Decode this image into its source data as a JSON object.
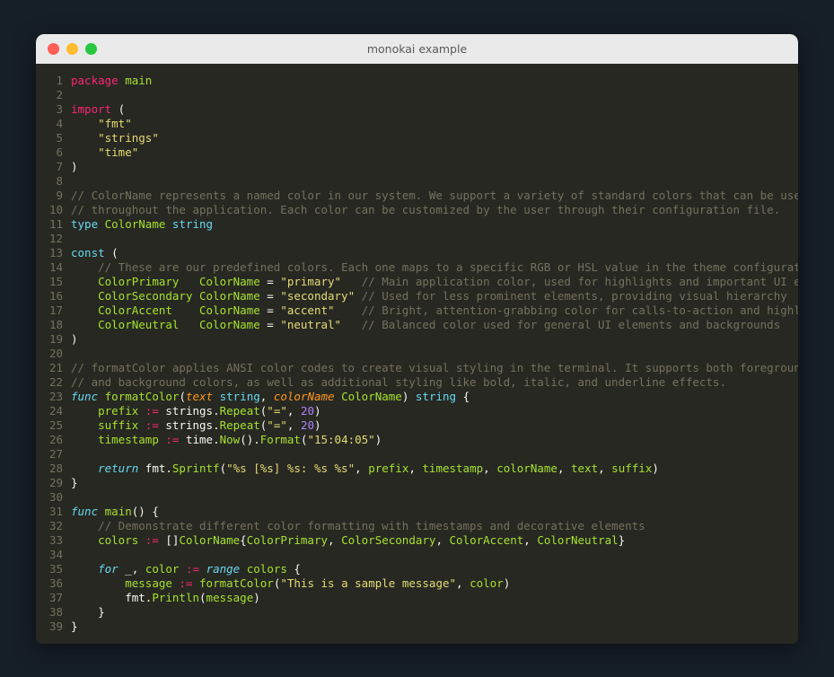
{
  "window": {
    "title": "monokai example",
    "traffic_lights": [
      {
        "name": "close-button",
        "color": "#ff5f57"
      },
      {
        "name": "minimize-button",
        "color": "#febc2e"
      },
      {
        "name": "maximize-button",
        "color": "#28c840"
      }
    ]
  },
  "theme": {
    "name": "monokai",
    "page_background": "#161e27",
    "titlebar_background": "#eaeaea",
    "titlebar_text": "#58595b",
    "code_background": "#272822",
    "foreground": "#f8f8f2",
    "comment": "#75715e",
    "keyword": "#f92672",
    "type_cyan": "#66d9ef",
    "identifier_green": "#a6e22e",
    "string_yellow": "#e6db74",
    "number_purple": "#ae81ff",
    "param_orange": "#fd971f",
    "linenumber": "#75715e"
  },
  "code": {
    "language": "go",
    "lines": [
      {
        "n": "1",
        "tokens": [
          {
            "t": "package",
            "c": "t-key"
          },
          {
            "t": " ",
            "c": "t-plain"
          },
          {
            "t": "main",
            "c": "t-fn"
          }
        ]
      },
      {
        "n": "2",
        "tokens": []
      },
      {
        "n": "3",
        "tokens": [
          {
            "t": "import",
            "c": "t-key"
          },
          {
            "t": " (",
            "c": "t-plain"
          }
        ]
      },
      {
        "n": "4",
        "tokens": [
          {
            "t": "    ",
            "c": "t-plain"
          },
          {
            "t": "\"fmt\"",
            "c": "t-str"
          }
        ]
      },
      {
        "n": "5",
        "tokens": [
          {
            "t": "    ",
            "c": "t-plain"
          },
          {
            "t": "\"strings\"",
            "c": "t-str"
          }
        ]
      },
      {
        "n": "6",
        "tokens": [
          {
            "t": "    ",
            "c": "t-plain"
          },
          {
            "t": "\"time\"",
            "c": "t-str"
          }
        ]
      },
      {
        "n": "7",
        "tokens": [
          {
            "t": ")",
            "c": "t-plain"
          }
        ]
      },
      {
        "n": "8",
        "tokens": []
      },
      {
        "n": "9",
        "tokens": [
          {
            "t": "// ColorName represents a named color in our system. We support a variety of standard colors that can be used",
            "c": "t-com"
          }
        ]
      },
      {
        "n": "10",
        "tokens": [
          {
            "t": "// throughout the application. Each color can be customized by the user through their configuration file.",
            "c": "t-com"
          }
        ]
      },
      {
        "n": "11",
        "tokens": [
          {
            "t": "type",
            "c": "t-kwp"
          },
          {
            "t": " ",
            "c": "t-plain"
          },
          {
            "t": "ColorName",
            "c": "t-fn"
          },
          {
            "t": " ",
            "c": "t-plain"
          },
          {
            "t": "string",
            "c": "t-kwp"
          }
        ]
      },
      {
        "n": "12",
        "tokens": []
      },
      {
        "n": "13",
        "tokens": [
          {
            "t": "const",
            "c": "t-kwp"
          },
          {
            "t": " (",
            "c": "t-plain"
          }
        ]
      },
      {
        "n": "14",
        "tokens": [
          {
            "t": "    ",
            "c": "t-plain"
          },
          {
            "t": "// These are our predefined colors. Each one maps to a specific RGB or HSL value in the theme configuration.",
            "c": "t-com"
          }
        ]
      },
      {
        "n": "15",
        "tokens": [
          {
            "t": "    ",
            "c": "t-plain"
          },
          {
            "t": "ColorPrimary",
            "c": "t-fn"
          },
          {
            "t": "   ",
            "c": "t-plain"
          },
          {
            "t": "ColorName",
            "c": "t-fn"
          },
          {
            "t": " = ",
            "c": "t-plain"
          },
          {
            "t": "\"primary\"",
            "c": "t-str"
          },
          {
            "t": "   ",
            "c": "t-plain"
          },
          {
            "t": "// Main application color, used for highlights and important UI elements",
            "c": "t-com"
          }
        ]
      },
      {
        "n": "16",
        "tokens": [
          {
            "t": "    ",
            "c": "t-plain"
          },
          {
            "t": "ColorSecondary",
            "c": "t-fn"
          },
          {
            "t": " ",
            "c": "t-plain"
          },
          {
            "t": "ColorName",
            "c": "t-fn"
          },
          {
            "t": " = ",
            "c": "t-plain"
          },
          {
            "t": "\"secondary\"",
            "c": "t-str"
          },
          {
            "t": " ",
            "c": "t-plain"
          },
          {
            "t": "// Used for less prominent elements, providing visual hierarchy",
            "c": "t-com"
          }
        ]
      },
      {
        "n": "17",
        "tokens": [
          {
            "t": "    ",
            "c": "t-plain"
          },
          {
            "t": "ColorAccent",
            "c": "t-fn"
          },
          {
            "t": "    ",
            "c": "t-plain"
          },
          {
            "t": "ColorName",
            "c": "t-fn"
          },
          {
            "t": " = ",
            "c": "t-plain"
          },
          {
            "t": "\"accent\"",
            "c": "t-str"
          },
          {
            "t": "    ",
            "c": "t-plain"
          },
          {
            "t": "// Bright, attention-grabbing color for calls-to-action and highlights",
            "c": "t-com"
          }
        ]
      },
      {
        "n": "18",
        "tokens": [
          {
            "t": "    ",
            "c": "t-plain"
          },
          {
            "t": "ColorNeutral",
            "c": "t-fn"
          },
          {
            "t": "   ",
            "c": "t-plain"
          },
          {
            "t": "ColorName",
            "c": "t-fn"
          },
          {
            "t": " = ",
            "c": "t-plain"
          },
          {
            "t": "\"neutral\"",
            "c": "t-str"
          },
          {
            "t": "   ",
            "c": "t-plain"
          },
          {
            "t": "// Balanced color used for general UI elements and backgrounds",
            "c": "t-com"
          }
        ]
      },
      {
        "n": "19",
        "tokens": [
          {
            "t": ")",
            "c": "t-plain"
          }
        ]
      },
      {
        "n": "20",
        "tokens": []
      },
      {
        "n": "21",
        "tokens": [
          {
            "t": "// formatColor applies ANSI color codes to create visual styling in the terminal. It supports both foreground",
            "c": "t-com"
          }
        ]
      },
      {
        "n": "22",
        "tokens": [
          {
            "t": "// and background colors, as well as additional styling like bold, italic, and underline effects.",
            "c": "t-com"
          }
        ]
      },
      {
        "n": "23",
        "tokens": [
          {
            "t": "func",
            "c": "t-kw2"
          },
          {
            "t": " ",
            "c": "t-plain"
          },
          {
            "t": "formatColor",
            "c": "t-fn"
          },
          {
            "t": "(",
            "c": "t-plain"
          },
          {
            "t": "text",
            "c": "t-param"
          },
          {
            "t": " ",
            "c": "t-plain"
          },
          {
            "t": "string",
            "c": "t-kwp"
          },
          {
            "t": ", ",
            "c": "t-plain"
          },
          {
            "t": "colorName",
            "c": "t-param"
          },
          {
            "t": " ",
            "c": "t-plain"
          },
          {
            "t": "ColorName",
            "c": "t-fn"
          },
          {
            "t": ") ",
            "c": "t-plain"
          },
          {
            "t": "string",
            "c": "t-kwp"
          },
          {
            "t": " {",
            "c": "t-plain"
          }
        ]
      },
      {
        "n": "24",
        "tokens": [
          {
            "t": "    ",
            "c": "t-plain"
          },
          {
            "t": "prefix",
            "c": "t-fn"
          },
          {
            "t": " ",
            "c": "t-plain"
          },
          {
            "t": ":=",
            "c": "t-op"
          },
          {
            "t": " ",
            "c": "t-plain"
          },
          {
            "t": "strings",
            "c": "t-plain"
          },
          {
            "t": ".",
            "c": "t-plain"
          },
          {
            "t": "Repeat",
            "c": "t-fn"
          },
          {
            "t": "(",
            "c": "t-plain"
          },
          {
            "t": "\"=\"",
            "c": "t-str"
          },
          {
            "t": ", ",
            "c": "t-plain"
          },
          {
            "t": "20",
            "c": "t-num"
          },
          {
            "t": ")",
            "c": "t-plain"
          }
        ]
      },
      {
        "n": "25",
        "tokens": [
          {
            "t": "    ",
            "c": "t-plain"
          },
          {
            "t": "suffix",
            "c": "t-fn"
          },
          {
            "t": " ",
            "c": "t-plain"
          },
          {
            "t": ":=",
            "c": "t-op"
          },
          {
            "t": " ",
            "c": "t-plain"
          },
          {
            "t": "strings",
            "c": "t-plain"
          },
          {
            "t": ".",
            "c": "t-plain"
          },
          {
            "t": "Repeat",
            "c": "t-fn"
          },
          {
            "t": "(",
            "c": "t-plain"
          },
          {
            "t": "\"=\"",
            "c": "t-str"
          },
          {
            "t": ", ",
            "c": "t-plain"
          },
          {
            "t": "20",
            "c": "t-num"
          },
          {
            "t": ")",
            "c": "t-plain"
          }
        ]
      },
      {
        "n": "26",
        "tokens": [
          {
            "t": "    ",
            "c": "t-plain"
          },
          {
            "t": "timestamp",
            "c": "t-fn"
          },
          {
            "t": " ",
            "c": "t-plain"
          },
          {
            "t": ":=",
            "c": "t-op"
          },
          {
            "t": " ",
            "c": "t-plain"
          },
          {
            "t": "time",
            "c": "t-plain"
          },
          {
            "t": ".",
            "c": "t-plain"
          },
          {
            "t": "Now",
            "c": "t-fn"
          },
          {
            "t": "().",
            "c": "t-plain"
          },
          {
            "t": "Format",
            "c": "t-fn"
          },
          {
            "t": "(",
            "c": "t-plain"
          },
          {
            "t": "\"15:04:05\"",
            "c": "t-str"
          },
          {
            "t": ")",
            "c": "t-plain"
          }
        ]
      },
      {
        "n": "27",
        "tokens": []
      },
      {
        "n": "28",
        "tokens": [
          {
            "t": "    ",
            "c": "t-plain"
          },
          {
            "t": "return",
            "c": "t-kw2"
          },
          {
            "t": " ",
            "c": "t-plain"
          },
          {
            "t": "fmt",
            "c": "t-plain"
          },
          {
            "t": ".",
            "c": "t-plain"
          },
          {
            "t": "Sprintf",
            "c": "t-fn"
          },
          {
            "t": "(",
            "c": "t-plain"
          },
          {
            "t": "\"%s [%s] %s: %s %s\"",
            "c": "t-str"
          },
          {
            "t": ", ",
            "c": "t-plain"
          },
          {
            "t": "prefix",
            "c": "t-fn"
          },
          {
            "t": ", ",
            "c": "t-plain"
          },
          {
            "t": "timestamp",
            "c": "t-fn"
          },
          {
            "t": ", ",
            "c": "t-plain"
          },
          {
            "t": "colorName",
            "c": "t-fn"
          },
          {
            "t": ", ",
            "c": "t-plain"
          },
          {
            "t": "text",
            "c": "t-fn"
          },
          {
            "t": ", ",
            "c": "t-plain"
          },
          {
            "t": "suffix",
            "c": "t-fn"
          },
          {
            "t": ")",
            "c": "t-plain"
          }
        ]
      },
      {
        "n": "29",
        "tokens": [
          {
            "t": "}",
            "c": "t-plain"
          }
        ]
      },
      {
        "n": "30",
        "tokens": []
      },
      {
        "n": "31",
        "tokens": [
          {
            "t": "func",
            "c": "t-kw2"
          },
          {
            "t": " ",
            "c": "t-plain"
          },
          {
            "t": "main",
            "c": "t-fn"
          },
          {
            "t": "() {",
            "c": "t-plain"
          }
        ]
      },
      {
        "n": "32",
        "tokens": [
          {
            "t": "    ",
            "c": "t-plain"
          },
          {
            "t": "// Demonstrate different color formatting with timestamps and decorative elements",
            "c": "t-com"
          }
        ]
      },
      {
        "n": "33",
        "tokens": [
          {
            "t": "    ",
            "c": "t-plain"
          },
          {
            "t": "colors",
            "c": "t-fn"
          },
          {
            "t": " ",
            "c": "t-plain"
          },
          {
            "t": ":=",
            "c": "t-op"
          },
          {
            "t": " []",
            "c": "t-plain"
          },
          {
            "t": "ColorName",
            "c": "t-fn"
          },
          {
            "t": "{",
            "c": "t-plain"
          },
          {
            "t": "ColorPrimary",
            "c": "t-fn"
          },
          {
            "t": ", ",
            "c": "t-plain"
          },
          {
            "t": "ColorSecondary",
            "c": "t-fn"
          },
          {
            "t": ", ",
            "c": "t-plain"
          },
          {
            "t": "ColorAccent",
            "c": "t-fn"
          },
          {
            "t": ", ",
            "c": "t-plain"
          },
          {
            "t": "ColorNeutral",
            "c": "t-fn"
          },
          {
            "t": "}",
            "c": "t-plain"
          }
        ]
      },
      {
        "n": "34",
        "tokens": []
      },
      {
        "n": "35",
        "tokens": [
          {
            "t": "    ",
            "c": "t-plain"
          },
          {
            "t": "for",
            "c": "t-kw2"
          },
          {
            "t": " ",
            "c": "t-plain"
          },
          {
            "t": "_",
            "c": "t-plain"
          },
          {
            "t": ", ",
            "c": "t-plain"
          },
          {
            "t": "color",
            "c": "t-fn"
          },
          {
            "t": " ",
            "c": "t-plain"
          },
          {
            "t": ":=",
            "c": "t-op"
          },
          {
            "t": " ",
            "c": "t-plain"
          },
          {
            "t": "range",
            "c": "t-kw2"
          },
          {
            "t": " ",
            "c": "t-plain"
          },
          {
            "t": "colors",
            "c": "t-fn"
          },
          {
            "t": " {",
            "c": "t-plain"
          }
        ]
      },
      {
        "n": "36",
        "tokens": [
          {
            "t": "        ",
            "c": "t-plain"
          },
          {
            "t": "message",
            "c": "t-fn"
          },
          {
            "t": " ",
            "c": "t-plain"
          },
          {
            "t": ":=",
            "c": "t-op"
          },
          {
            "t": " ",
            "c": "t-plain"
          },
          {
            "t": "formatColor",
            "c": "t-fn"
          },
          {
            "t": "(",
            "c": "t-plain"
          },
          {
            "t": "\"This is a sample message\"",
            "c": "t-str"
          },
          {
            "t": ", ",
            "c": "t-plain"
          },
          {
            "t": "color",
            "c": "t-fn"
          },
          {
            "t": ")",
            "c": "t-plain"
          }
        ]
      },
      {
        "n": "37",
        "tokens": [
          {
            "t": "        ",
            "c": "t-plain"
          },
          {
            "t": "fmt",
            "c": "t-plain"
          },
          {
            "t": ".",
            "c": "t-plain"
          },
          {
            "t": "Println",
            "c": "t-fn"
          },
          {
            "t": "(",
            "c": "t-plain"
          },
          {
            "t": "message",
            "c": "t-fn"
          },
          {
            "t": ")",
            "c": "t-plain"
          }
        ]
      },
      {
        "n": "38",
        "tokens": [
          {
            "t": "    }",
            "c": "t-plain"
          }
        ]
      },
      {
        "n": "39",
        "tokens": [
          {
            "t": "}",
            "c": "t-plain"
          }
        ]
      }
    ]
  }
}
